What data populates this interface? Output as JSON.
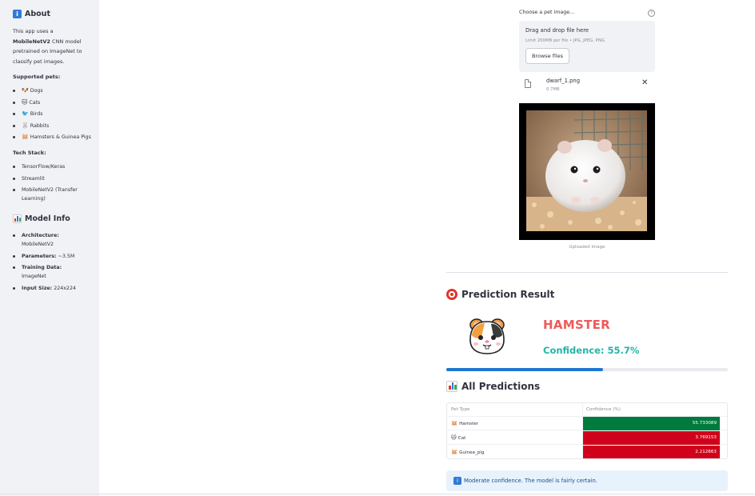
{
  "sidebar": {
    "about_title": "About",
    "about_intro_pre": "This app uses a ",
    "about_model": "MobileNetV2",
    "about_intro_post": " CNN model pretrained on ImageNet to classify pet images.",
    "supported_title": "Supported pets:",
    "pets": [
      {
        "icon": "🐶",
        "label": "Dogs"
      },
      {
        "icon": "🐱",
        "label": "Cats"
      },
      {
        "icon": "🐦",
        "label": "Birds"
      },
      {
        "icon": "🐰",
        "label": "Rabbits"
      },
      {
        "icon": "🐹",
        "label": "Hamsters & Guinea Pigs"
      }
    ],
    "tech_title": "Tech Stack:",
    "tech": [
      "TensorFlow/Keras",
      "Streamlit",
      "MobileNetV2 (Transfer Learning)"
    ],
    "model_info_title": "Model Info",
    "model_info": [
      {
        "key": "Architecture:",
        "value": "MobileNetV2"
      },
      {
        "key": "Parameters:",
        "value": "~3.5M"
      },
      {
        "key": "Training Data:",
        "value": "ImageNet"
      },
      {
        "key": "Input Size:",
        "value": "224x224"
      }
    ]
  },
  "uploader": {
    "label": "Choose a pet image...",
    "drag_text": "Drag and drop file here",
    "limit_text": "Limit 200MB per file • JPG, JPEG, PNG",
    "browse_label": "Browse files",
    "file_name": "dwarf_1.png",
    "file_size": "0.7MB",
    "image_caption": "Uploaded Image"
  },
  "prediction": {
    "title": "Prediction Result",
    "label": "HAMSTER",
    "confidence_text": "Confidence: 55.7%",
    "confidence_fraction": 0.557
  },
  "all_predictions": {
    "title": "All Predictions",
    "columns": [
      "Pet Type",
      "Confidence (%)"
    ],
    "rows": [
      {
        "icon": "🐹",
        "pet": "Hamster",
        "confidence": "55.733089",
        "color": "#007a3d"
      },
      {
        "icon": "🐱",
        "pet": "Cat",
        "confidence": "3.769153",
        "color": "#d0021b"
      },
      {
        "icon": "🐹",
        "pet": "Guinea_pig",
        "confidence": "2.212863",
        "color": "#d0021b"
      }
    ]
  },
  "alert": {
    "text": "Moderate confidence. The model is fairly certain."
  },
  "colors": {
    "accent_blue": "#1f77d0",
    "prediction_red": "#ef5a5a",
    "confidence_teal": "#21b6a8"
  }
}
